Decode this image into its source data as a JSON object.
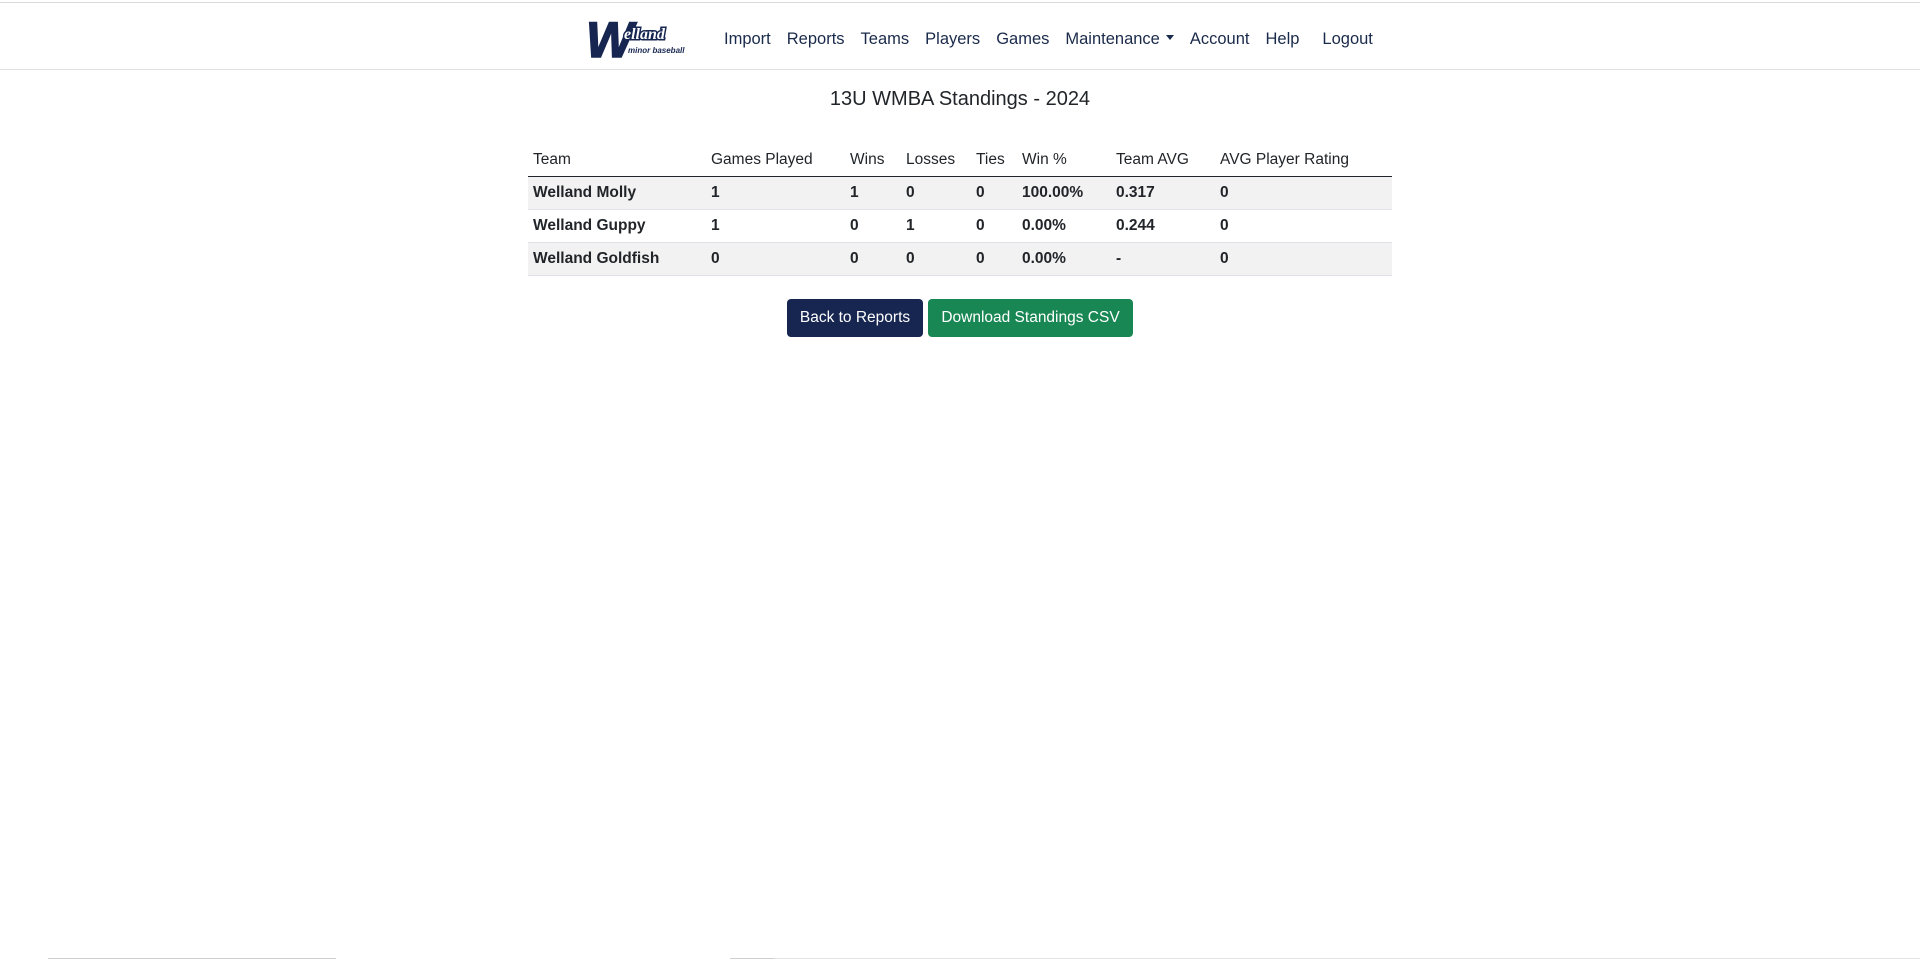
{
  "nav": {
    "logo_text_big": "W",
    "logo_text_script": "elland",
    "logo_text_small": "minor baseball",
    "items": [
      {
        "label": "Import"
      },
      {
        "label": "Reports"
      },
      {
        "label": "Teams"
      },
      {
        "label": "Players"
      },
      {
        "label": "Games"
      },
      {
        "label": "Maintenance"
      },
      {
        "label": "Account"
      },
      {
        "label": "Help"
      },
      {
        "label": "Logout"
      }
    ]
  },
  "page": {
    "title": "13U WMBA Standings - 2024"
  },
  "table": {
    "headers": [
      "Team",
      "Games Played",
      "Wins",
      "Losses",
      "Ties",
      "Win %",
      "Team AVG",
      "AVG Player Rating"
    ],
    "rows": [
      [
        "Welland Molly",
        "1",
        "1",
        "0",
        "0",
        "100.00%",
        "0.317",
        "0"
      ],
      [
        "Welland Guppy",
        "1",
        "0",
        "1",
        "0",
        "0.00%",
        "0.244",
        "0"
      ],
      [
        "Welland Goldfish",
        "0",
        "0",
        "0",
        "0",
        "0.00%",
        "-",
        "0"
      ]
    ]
  },
  "actions": {
    "back_label": "Back to Reports",
    "download_label": "Download Standings CSV"
  },
  "colors": {
    "navy": "#172650",
    "green": "#198754",
    "row_stripe": "#f2f2f2"
  }
}
